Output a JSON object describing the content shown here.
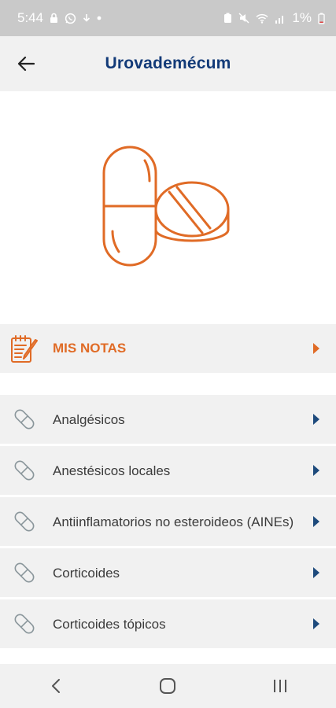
{
  "status_bar": {
    "time": "5:44",
    "battery": "1%"
  },
  "app_bar": {
    "title": "Urovademécum"
  },
  "notes": {
    "label": "MIS NOTAS"
  },
  "categories": [
    {
      "label": "Analgésicos"
    },
    {
      "label": "Anestésicos locales"
    },
    {
      "label": "Antiinflamatorios no esteroideos (AINEs)"
    },
    {
      "label": "Corticoides"
    },
    {
      "label": "Corticoides tópicos"
    }
  ],
  "colors": {
    "brand_orange": "#e06b26",
    "title_blue": "#123a78",
    "chevron_blue": "#1d4a7c"
  },
  "icons": [
    "back-arrow-icon",
    "pill-capsule-icon",
    "notepad-icon",
    "chevron-right-icon",
    "nav-back-icon",
    "nav-home-icon",
    "nav-recents-icon"
  ]
}
